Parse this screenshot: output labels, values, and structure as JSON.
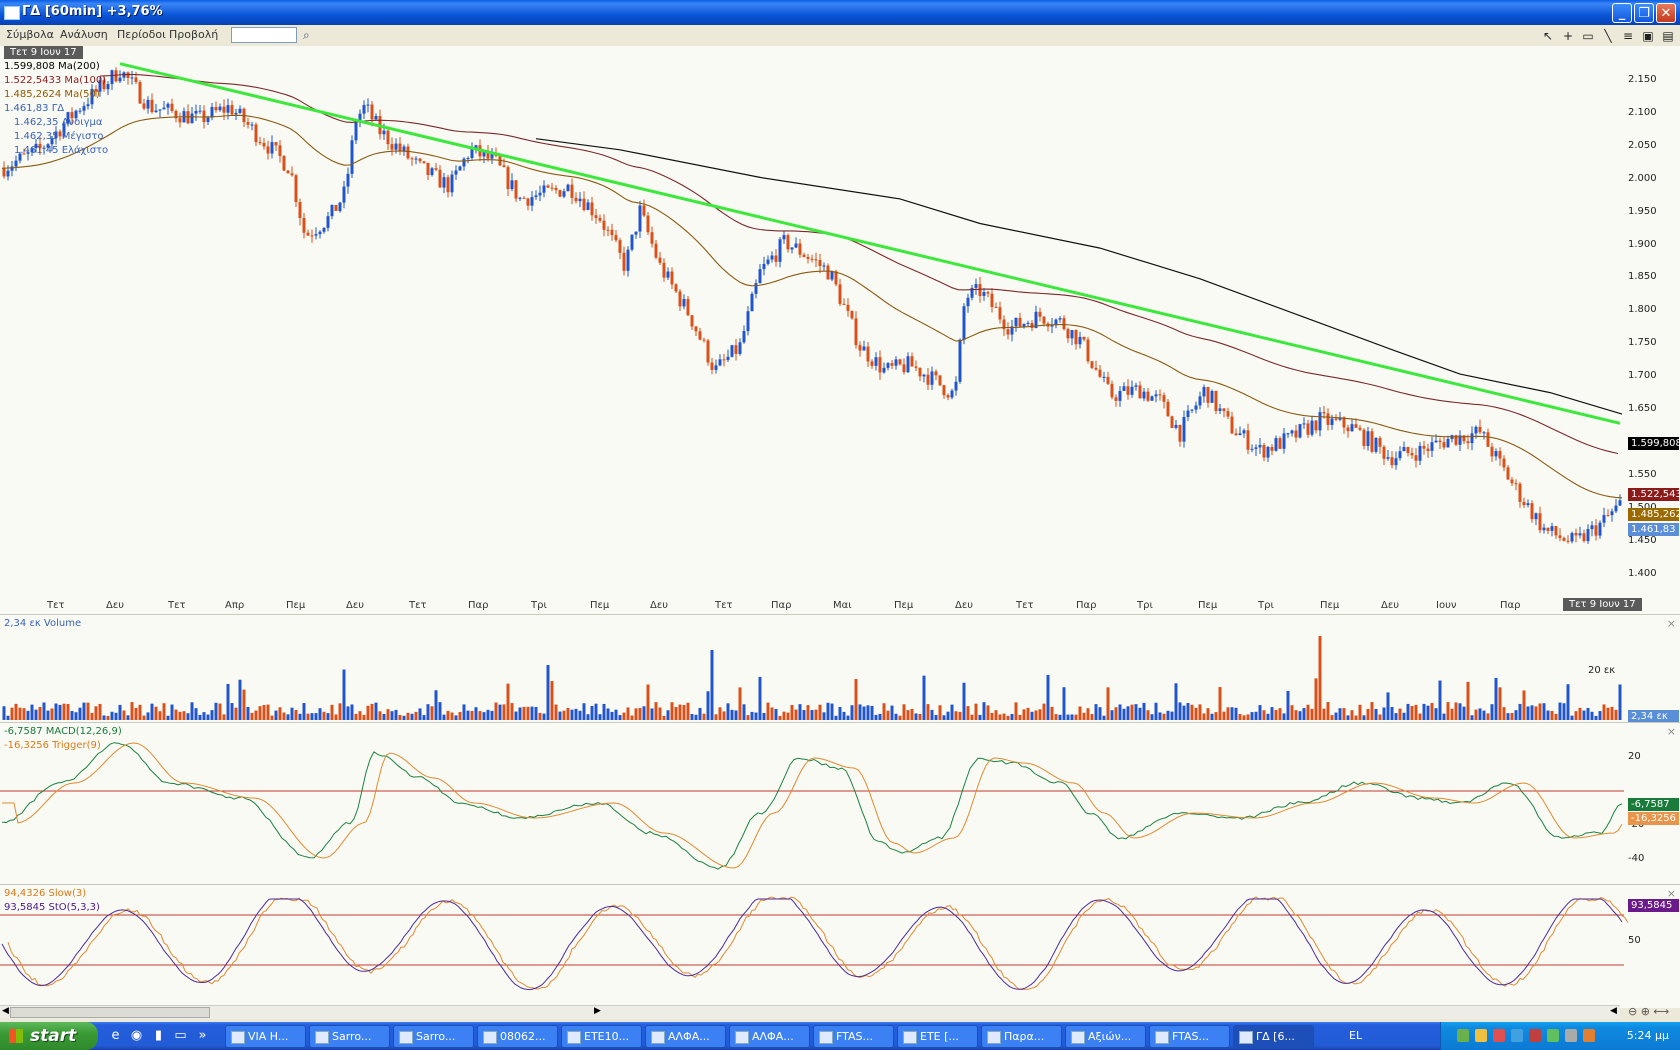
{
  "window": {
    "title": "ΓΔ [60min] +3,76%"
  },
  "menu": {
    "items": [
      "Σύμβολα",
      "Ανάλυση",
      "Περίοδοι",
      "Προβολή"
    ],
    "symbol_input": ""
  },
  "chart": {
    "date_label_top": "Τετ 9 Ιουν 17",
    "date_label_bottom": "Τετ 9 Ιουν 17",
    "legend": [
      {
        "text": "1.599,808 Ma(200)",
        "color": "#000000"
      },
      {
        "text": "1.522,5433 Ma(100)",
        "color": "#8b1a1a"
      },
      {
        "text": "1.485,2624 Ma(50)",
        "color": "#8b5a00"
      },
      {
        "text": "1.461,83 ΓΔ",
        "color": "#3a63b5"
      },
      {
        "text": "1.462,35 Ανοιγμα",
        "color": "#3a63b5"
      },
      {
        "text": "1.462,35 Μέγιστο",
        "color": "#3a63b5"
      },
      {
        "text": "1.461,45 Ελάχιστο",
        "color": "#3a63b5"
      }
    ],
    "y_ticks": [
      "2.150",
      "2.100",
      "2.050",
      "2.000",
      "1.950",
      "1.900",
      "1.850",
      "1.800",
      "1.750",
      "1.700",
      "1.650",
      "1.600",
      "1.550",
      "1.500",
      "1.450",
      "1.400"
    ],
    "x_ticks": [
      "Τετ",
      "Δευ",
      "Τετ",
      "Απρ",
      "Πεμ",
      "Δευ",
      "Τετ",
      "Παρ",
      "Τρι",
      "Πεμ",
      "Δευ",
      "Τετ",
      "Παρ",
      "Μαι",
      "Πεμ",
      "Δευ",
      "Τετ",
      "Παρ",
      "Τρι",
      "Πεμ",
      "Τρι",
      "Πεμ",
      "Δευ",
      "Ιουν",
      "Παρ"
    ],
    "price_tags": [
      {
        "text": "1.599,808",
        "color": "#000000"
      },
      {
        "text": "1.522,543",
        "color": "#8b1a1a"
      },
      {
        "text": "1.485,262",
        "color": "#9a6a00"
      },
      {
        "text": "1.461,83",
        "color": "#5a8fd8"
      }
    ]
  },
  "volume": {
    "legend": "2,34 εκ Volume",
    "tick": "20 εκ",
    "tag": "2,34 εκ"
  },
  "macd": {
    "legend_macd": "-6,7587 MACD(12,26,9)",
    "legend_trigger": "-16,3256 Trigger(9)",
    "ticks": [
      "20",
      "-20",
      "-40"
    ],
    "tag_macd": "-6,7587",
    "tag_trigger": "-16,3256"
  },
  "stoch": {
    "legend_slow": "94,4326 Slow(3)",
    "legend_sto": "93,5845 StO(5,3,3)",
    "tick": "50",
    "tag": "93,5845"
  },
  "taskbar": {
    "start_label": "start",
    "tasks": [
      "VIA H...",
      "Sarro...",
      "Sarro...",
      "08062...",
      "ETE10...",
      "ΑΛΦΑ...",
      "ΑΛΦΑ...",
      "FTAS...",
      "ETE [...",
      "Παρα...",
      "Αξιών...",
      "FTAS...",
      "ΓΔ [6..."
    ],
    "language": "EL",
    "clock": "5:24 μμ"
  }
}
